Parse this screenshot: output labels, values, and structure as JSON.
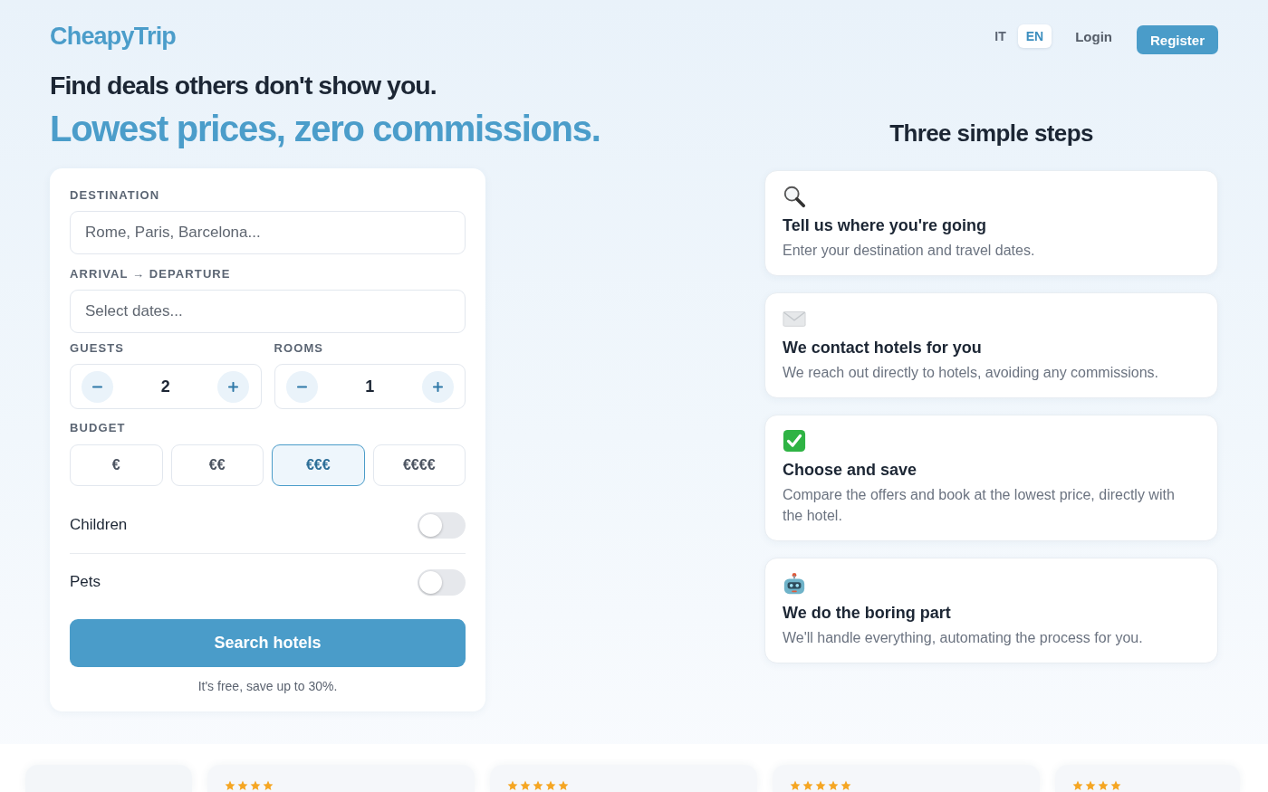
{
  "header": {
    "logo": "CheapyTrip",
    "languages": [
      {
        "label": "IT",
        "selected": false
      },
      {
        "label": "EN",
        "selected": true
      }
    ],
    "login": "Login",
    "register": "Register"
  },
  "hero": {
    "headline": "Find deals others don't show you.",
    "tagline": "Lowest prices, zero commissions."
  },
  "search_form": {
    "destination": {
      "label": "DESTINATION",
      "placeholder": "Rome, Paris, Barcelona..."
    },
    "dates": {
      "label": "ARRIVAL → DEPARTURE",
      "placeholder": "Select dates..."
    },
    "counters": [
      {
        "label": "GUESTS",
        "value": "2"
      },
      {
        "label": "ROOMS",
        "value": "1"
      }
    ],
    "budget": {
      "label": "BUDGET",
      "options": [
        {
          "label": "€",
          "selected": false
        },
        {
          "label": "€€",
          "selected": false
        },
        {
          "label": "€€€",
          "selected": true
        },
        {
          "label": "€€€€",
          "selected": false
        }
      ]
    },
    "toggles": [
      {
        "label": "Children",
        "on": false
      },
      {
        "label": "Pets",
        "on": false
      }
    ],
    "submit": "Search hotels",
    "note": "It's free, save up to 30%."
  },
  "steps": {
    "title": "Three simple steps",
    "items": [
      {
        "kind": "search",
        "title": "Tell us where you're going",
        "text": "Enter your destination and travel dates."
      },
      {
        "kind": "mail",
        "title": "We contact hotels for you",
        "text": "We reach out directly to hotels, avoiding any commissions."
      },
      {
        "kind": "check",
        "title": "Choose and save",
        "text": "Compare the offers and book at the lowest price, directly with the hotel."
      },
      {
        "kind": "robot",
        "title": "We do the boring part",
        "text": "We'll handle everything, automating the process for you."
      }
    ]
  },
  "cards": [
    {
      "kind": "blank"
    },
    {
      "kind": "rated",
      "stars": 4
    },
    {
      "kind": "rated",
      "stars": 5
    },
    {
      "kind": "rated",
      "stars": 5
    },
    {
      "kind": "rated",
      "stars": 4
    }
  ]
}
